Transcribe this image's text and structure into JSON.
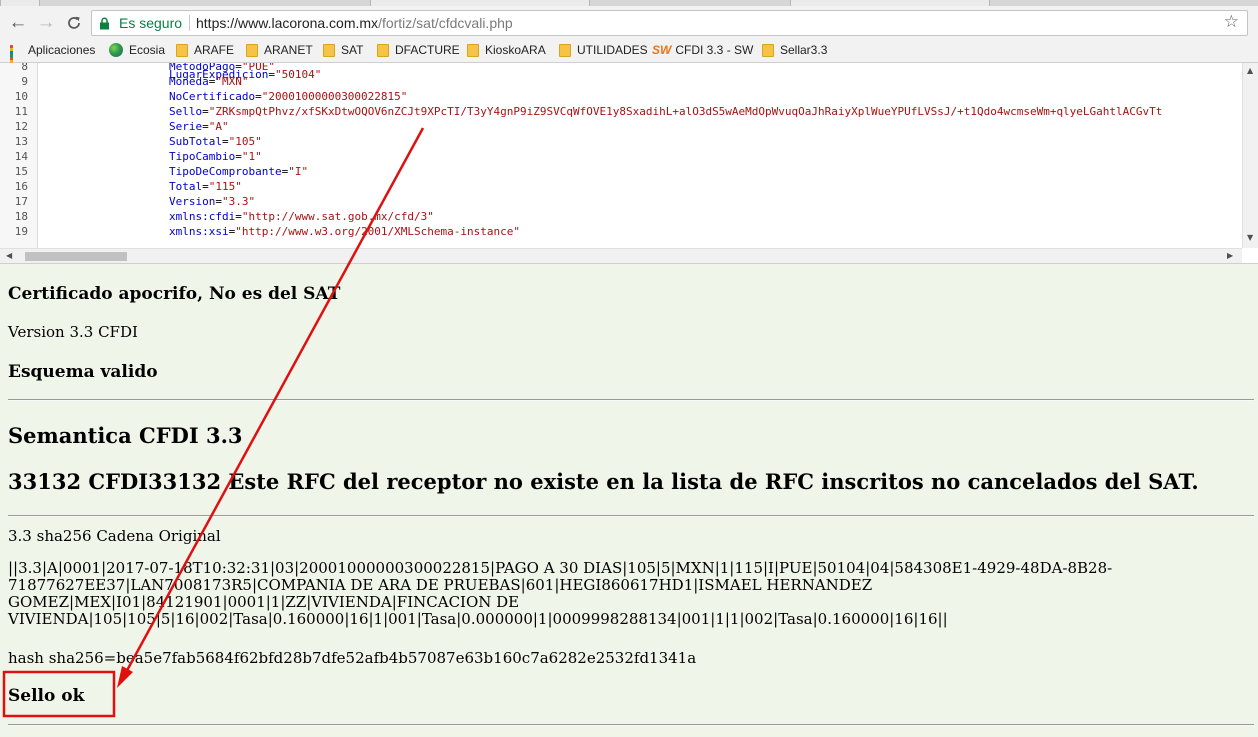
{
  "browser": {
    "secure_label": "Es seguro",
    "url_host": "https://www.lacorona.com.mx",
    "url_path": "/fortiz/sat/cfdcvali.php",
    "bookmarks": [
      {
        "label": "Aplicaciones",
        "icon": "apps-icon"
      },
      {
        "label": "Ecosia",
        "icon": "globe-icon"
      },
      {
        "label": "ARAFE",
        "icon": "folder-icon"
      },
      {
        "label": "ARANET",
        "icon": "folder-icon"
      },
      {
        "label": "SAT",
        "icon": "folder-icon"
      },
      {
        "label": "DFACTURE",
        "icon": "folder-icon"
      },
      {
        "label": "KioskoARA",
        "icon": "folder-icon"
      },
      {
        "label": "UTILIDADES",
        "icon": "folder-icon"
      },
      {
        "label": "CFDI 3.3 - SW",
        "icon": "sw-icon",
        "icon_text": "SW"
      },
      {
        "label": "Sellar3.3",
        "icon": "folder-icon"
      }
    ]
  },
  "editor": {
    "lines": [
      {
        "num": "8",
        "attr": "MetodoPago",
        "value": "\"PUE\""
      },
      {
        "num": "9",
        "attr": "Moneda",
        "value": "\"MXN\""
      },
      {
        "num": "10",
        "attr": "NoCertificado",
        "value": "\"20001000000300022815\""
      },
      {
        "num": "11",
        "attr": "Sello",
        "value": "\"ZRKsmpQtPhvz/xfSKxDtwOQOV6nZCJt9XPcTI/T3yY4gnP9iZ9SVCqWfOVE1y8SxadihL+alO3dS5wAeMdOpWvuqOaJhRaiyXplWueYPUfLVSsJ/+t1Qdo4wcmseWm+qlyeLGahtlACGvTt"
      },
      {
        "num": "12",
        "attr": "Serie",
        "value": "\"A\""
      },
      {
        "num": "13",
        "attr": "SubTotal",
        "value": "\"105\""
      },
      {
        "num": "14",
        "attr": "TipoCambio",
        "value": "\"1\""
      },
      {
        "num": "15",
        "attr": "TipoDeComprobante",
        "value": "\"I\""
      },
      {
        "num": "16",
        "attr": "Total",
        "value": "\"115\""
      },
      {
        "num": "17",
        "attr": "Version",
        "value": "\"3.3\""
      },
      {
        "num": "18",
        "attr": "xmlns:cfdi",
        "value": "\"http://www.sat.gob.mx/cfd/3\""
      },
      {
        "num": "19",
        "attr": "xmlns:xsi",
        "value": "\"http://www.w3.org/2001/XMLSchema-instance\""
      }
    ],
    "partial_top": {
      "attr": "LugarExpedicion",
      "value": "\"50104\""
    }
  },
  "content": {
    "cert_status": "Certificado apocrifo, No es del SAT",
    "version_text": "Version 3.3 CFDI",
    "schema_status": "Esquema valido",
    "semantica_title": "Semantica CFDI 3.3",
    "error_msg": "33132 CFDI33132 Este RFC del receptor no existe en la lista de RFC inscritos no cancelados del SAT.",
    "cadena_label": "3.3 sha256 Cadena Original",
    "cadena": "||3.3|A|0001|2017-07-18T10:32:31|03|20001000000300022815|PAGO A 30 DIAS|105|5|MXN|1|115|I|PUE|50104|04|584308E1-4929-48DA-8B28-71877627EE37|LAN7008173R5|COMPANIA DE ARA DE PRUEBAS|601|HEGI860617HD1|ISMAEL HERNANDEZ GOMEZ|MEX|I01|84121901|0001|1|ZZ|VIVIENDA|FINCACION DE VIVIENDA|105|105|5|16|002|Tasa|0.160000|16|1|001|Tasa|0.000000|1|0009998288134|001|1|1|002|Tasa|0.160000|16|16||",
    "hash": "hash sha256=bea5e7fab5684f62bfd28b7dfe52afb4b57087e63b160c7a6282e2532fd1341a",
    "sello_status": "Sello ok"
  },
  "colors": {
    "page_bg": "#f0f5e9",
    "annotation": "#e01010",
    "xml_attr": "#0000cc",
    "xml_string": "#aa1111",
    "secure": "#0b8043"
  }
}
